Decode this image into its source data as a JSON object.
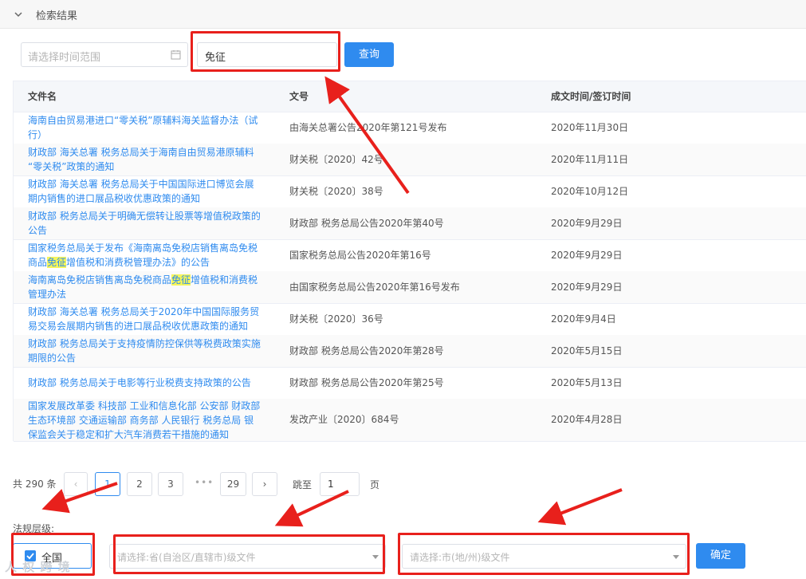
{
  "header": {
    "title": "检索结果"
  },
  "search": {
    "date_placeholder": "请选择时间范围",
    "keyword_value": "免征",
    "query_label": "查询"
  },
  "table": {
    "headers": [
      "文件名",
      "文号",
      "成文时间/签订时间"
    ],
    "rows": [
      {
        "name_l1": "海南自由贸易港进口“零关税”原辅料海关监督办法（试",
        "name_l2": "行）",
        "doc_no": "由海关总署公告2020年第121号发布",
        "date": "2020年11月30日"
      },
      {
        "name_l1": "财政部 海关总署 税务总局关于海南自由贸易港原辅料",
        "name_l2": "“零关税”政策的通知",
        "doc_no": "财关税〔2020〕42号",
        "date": "2020年11月11日"
      },
      {
        "name_l1": "财政部 海关总署 税务总局关于中国国际进口博览会展",
        "name_l2": "期内销售的进口展品税收优惠政策的通知",
        "doc_no": "财关税〔2020〕38号",
        "date": "2020年10月12日"
      },
      {
        "name_l1": "财政部 税务总局关于明确无偿转让股票等增值税政策的",
        "name_l2": "公告",
        "doc_no": "财政部 税务总局公告2020年第40号",
        "date": "2020年9月29日"
      },
      {
        "name_l1": "国家税务总局关于发布《海南离岛免税店销售离岛免税",
        "name_l2a": "商品",
        "name_hl": "免征",
        "name_l2b": "增值税和消费税管理办法》的公告",
        "doc_no": "国家税务总局公告2020年第16号",
        "date": "2020年9月29日"
      },
      {
        "name_l1a": "海南离岛免税店销售离岛免税商品",
        "name_hl": "免征",
        "name_l1b": "增值税和消费税",
        "name_l2": "管理办法",
        "doc_no": "由国家税务总局公告2020年第16号发布",
        "date": "2020年9月29日"
      },
      {
        "name_l1": "财政部 海关总署 税务总局关于2020年中国国际服务贸",
        "name_l2": "易交易会展期内销售的进口展品税收优惠政策的通知",
        "doc_no": "财关税〔2020〕36号",
        "date": "2020年9月4日"
      },
      {
        "name_l1": "财政部 税务总局关于支持疫情防控保供等税费政策实施",
        "name_l2": "期限的公告",
        "doc_no": "财政部 税务总局公告2020年第28号",
        "date": "2020年5月15日"
      },
      {
        "name_l1": "财政部 税务总局关于电影等行业税费支持政策的公告",
        "doc_no": "财政部 税务总局公告2020年第25号",
        "date": "2020年5月13日"
      },
      {
        "name_l1": "国家发展改革委 科技部 工业和信息化部 公安部 财政部",
        "name_l2": "生态环境部 交通运输部 商务部 人民银行 税务总局 银",
        "name_l3": "保监会关于稳定和扩大汽车消费若干措施的通知",
        "doc_no": "发改产业〔2020〕684号",
        "date": "2020年4月28日"
      }
    ]
  },
  "pagination": {
    "total": "共 290 条",
    "prev": "‹",
    "pages": [
      "1",
      "2",
      "3"
    ],
    "ellipsis": "•••",
    "last": "29",
    "next": "›",
    "goto_label": "跳至",
    "goto_value": "1",
    "goto_unit": "页",
    "current": 1
  },
  "filters": {
    "level_label": "法规层级:",
    "national_label": "全国",
    "province_placeholder": "请选择:省(自治区/直辖市)级文件",
    "city_placeholder": "请选择:市(地/州)级文件",
    "confirm_label": "确定"
  },
  "watermark": "人 权 跨 境",
  "colors": {
    "accent": "#2f8bef",
    "annotation": "#e8201c",
    "highlight": "#f5f55a"
  }
}
